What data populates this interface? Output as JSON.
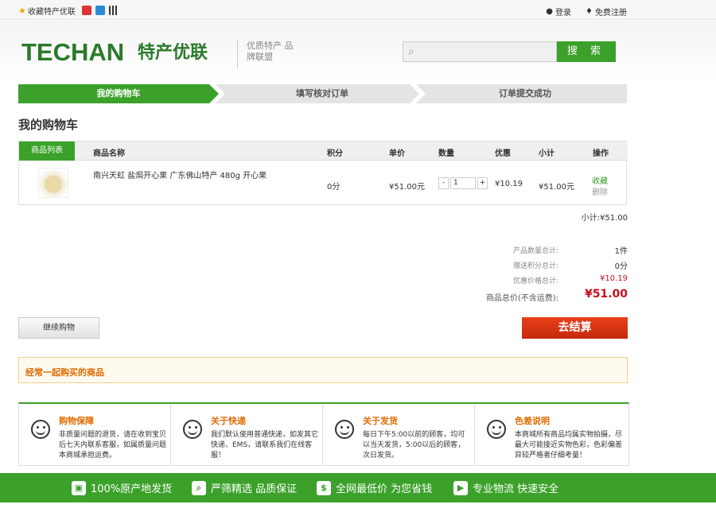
{
  "topbar": {
    "favorite": "收藏特产优联",
    "login": "登录",
    "register": "免费注册"
  },
  "header": {
    "logo_text": "TECHAN",
    "logo_cn": "特产优联",
    "slogan": "优质特产 品牌联盟",
    "search_placeholder": "",
    "search_btn": "搜 索"
  },
  "steps": [
    "我的购物车",
    "填写核对订单",
    "订单提交成功"
  ],
  "page_title": "我的购物车",
  "table": {
    "headers": {
      "list": "商品列表",
      "name": "商品名称",
      "points": "积分",
      "price": "单价",
      "qty": "数量",
      "discount": "优惠",
      "subtotal": "小计",
      "action": "操作"
    },
    "row": {
      "name": "南兴天虹 盐焗开心果 广东佛山特产 480g 开心果",
      "points": "0分",
      "price": "¥51.00元",
      "qty": "1",
      "minus": "-",
      "plus": "+",
      "discount": "¥10.19",
      "subtotal": "¥51.00元",
      "fav": "收藏",
      "del": "删除"
    }
  },
  "subtotal_line": "小计:¥51.00",
  "summary": [
    {
      "label": "产品数量总计:",
      "value": "1件"
    },
    {
      "label": "赠送积分总计:",
      "value": "0分"
    },
    {
      "label": "优惠价格总计:",
      "value": "¥10.19"
    },
    {
      "label": "商品总价(不含运费):",
      "value": "¥51.00"
    }
  ],
  "buttons": {
    "continue": "继续购物",
    "checkout": "去结算"
  },
  "often": "经常一起购买的商品",
  "services": [
    {
      "title": "购物保障",
      "desc": "非质量问题的退货，请在收到宝贝后七天内联系客服，如属质量问题本商城承担运费。"
    },
    {
      "title": "关于快递",
      "desc": "我们默认使用普通快递，如发其它快递、EMS，请联系我们在线客服！"
    },
    {
      "title": "关于发货",
      "desc": "每日下午5:00以前的顾客，均可以当天发货，5:00以后的顾客，次日发货。"
    },
    {
      "title": "色差说明",
      "desc": "本商城所有商品均属实物拍摄，尽最大可能接近实物色彩，色彩偏差异较严格者仔细考量！"
    }
  ],
  "footer": [
    "100%原产地发货",
    "严筛精选 品质保证",
    "全网最低价 为您省钱",
    "专业物流 快速安全"
  ],
  "colors": {
    "brand_green": "#3ba12a",
    "checkout_red": "#d7340f",
    "price_red": "#c8101e"
  }
}
